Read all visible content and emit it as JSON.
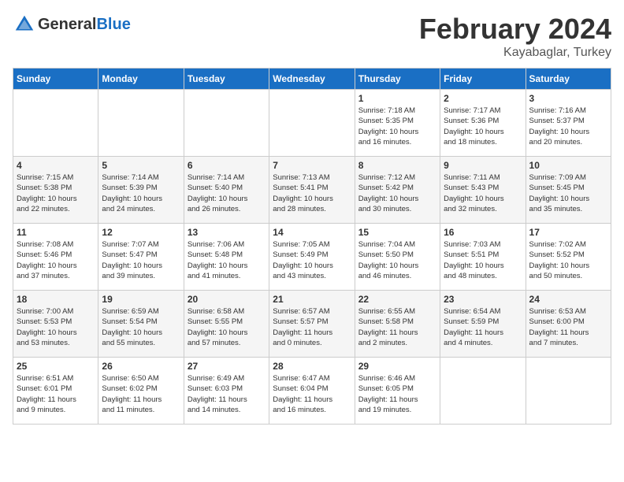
{
  "header": {
    "logo_general": "General",
    "logo_blue": "Blue",
    "month_title": "February 2024",
    "subtitle": "Kayabaglar, Turkey"
  },
  "days_of_week": [
    "Sunday",
    "Monday",
    "Tuesday",
    "Wednesday",
    "Thursday",
    "Friday",
    "Saturday"
  ],
  "weeks": [
    [
      {
        "day": "",
        "info": ""
      },
      {
        "day": "",
        "info": ""
      },
      {
        "day": "",
        "info": ""
      },
      {
        "day": "",
        "info": ""
      },
      {
        "day": "1",
        "info": "Sunrise: 7:18 AM\nSunset: 5:35 PM\nDaylight: 10 hours\nand 16 minutes."
      },
      {
        "day": "2",
        "info": "Sunrise: 7:17 AM\nSunset: 5:36 PM\nDaylight: 10 hours\nand 18 minutes."
      },
      {
        "day": "3",
        "info": "Sunrise: 7:16 AM\nSunset: 5:37 PM\nDaylight: 10 hours\nand 20 minutes."
      }
    ],
    [
      {
        "day": "4",
        "info": "Sunrise: 7:15 AM\nSunset: 5:38 PM\nDaylight: 10 hours\nand 22 minutes."
      },
      {
        "day": "5",
        "info": "Sunrise: 7:14 AM\nSunset: 5:39 PM\nDaylight: 10 hours\nand 24 minutes."
      },
      {
        "day": "6",
        "info": "Sunrise: 7:14 AM\nSunset: 5:40 PM\nDaylight: 10 hours\nand 26 minutes."
      },
      {
        "day": "7",
        "info": "Sunrise: 7:13 AM\nSunset: 5:41 PM\nDaylight: 10 hours\nand 28 minutes."
      },
      {
        "day": "8",
        "info": "Sunrise: 7:12 AM\nSunset: 5:42 PM\nDaylight: 10 hours\nand 30 minutes."
      },
      {
        "day": "9",
        "info": "Sunrise: 7:11 AM\nSunset: 5:43 PM\nDaylight: 10 hours\nand 32 minutes."
      },
      {
        "day": "10",
        "info": "Sunrise: 7:09 AM\nSunset: 5:45 PM\nDaylight: 10 hours\nand 35 minutes."
      }
    ],
    [
      {
        "day": "11",
        "info": "Sunrise: 7:08 AM\nSunset: 5:46 PM\nDaylight: 10 hours\nand 37 minutes."
      },
      {
        "day": "12",
        "info": "Sunrise: 7:07 AM\nSunset: 5:47 PM\nDaylight: 10 hours\nand 39 minutes."
      },
      {
        "day": "13",
        "info": "Sunrise: 7:06 AM\nSunset: 5:48 PM\nDaylight: 10 hours\nand 41 minutes."
      },
      {
        "day": "14",
        "info": "Sunrise: 7:05 AM\nSunset: 5:49 PM\nDaylight: 10 hours\nand 43 minutes."
      },
      {
        "day": "15",
        "info": "Sunrise: 7:04 AM\nSunset: 5:50 PM\nDaylight: 10 hours\nand 46 minutes."
      },
      {
        "day": "16",
        "info": "Sunrise: 7:03 AM\nSunset: 5:51 PM\nDaylight: 10 hours\nand 48 minutes."
      },
      {
        "day": "17",
        "info": "Sunrise: 7:02 AM\nSunset: 5:52 PM\nDaylight: 10 hours\nand 50 minutes."
      }
    ],
    [
      {
        "day": "18",
        "info": "Sunrise: 7:00 AM\nSunset: 5:53 PM\nDaylight: 10 hours\nand 53 minutes."
      },
      {
        "day": "19",
        "info": "Sunrise: 6:59 AM\nSunset: 5:54 PM\nDaylight: 10 hours\nand 55 minutes."
      },
      {
        "day": "20",
        "info": "Sunrise: 6:58 AM\nSunset: 5:55 PM\nDaylight: 10 hours\nand 57 minutes."
      },
      {
        "day": "21",
        "info": "Sunrise: 6:57 AM\nSunset: 5:57 PM\nDaylight: 11 hours\nand 0 minutes."
      },
      {
        "day": "22",
        "info": "Sunrise: 6:55 AM\nSunset: 5:58 PM\nDaylight: 11 hours\nand 2 minutes."
      },
      {
        "day": "23",
        "info": "Sunrise: 6:54 AM\nSunset: 5:59 PM\nDaylight: 11 hours\nand 4 minutes."
      },
      {
        "day": "24",
        "info": "Sunrise: 6:53 AM\nSunset: 6:00 PM\nDaylight: 11 hours\nand 7 minutes."
      }
    ],
    [
      {
        "day": "25",
        "info": "Sunrise: 6:51 AM\nSunset: 6:01 PM\nDaylight: 11 hours\nand 9 minutes."
      },
      {
        "day": "26",
        "info": "Sunrise: 6:50 AM\nSunset: 6:02 PM\nDaylight: 11 hours\nand 11 minutes."
      },
      {
        "day": "27",
        "info": "Sunrise: 6:49 AM\nSunset: 6:03 PM\nDaylight: 11 hours\nand 14 minutes."
      },
      {
        "day": "28",
        "info": "Sunrise: 6:47 AM\nSunset: 6:04 PM\nDaylight: 11 hours\nand 16 minutes."
      },
      {
        "day": "29",
        "info": "Sunrise: 6:46 AM\nSunset: 6:05 PM\nDaylight: 11 hours\nand 19 minutes."
      },
      {
        "day": "",
        "info": ""
      },
      {
        "day": "",
        "info": ""
      }
    ]
  ]
}
